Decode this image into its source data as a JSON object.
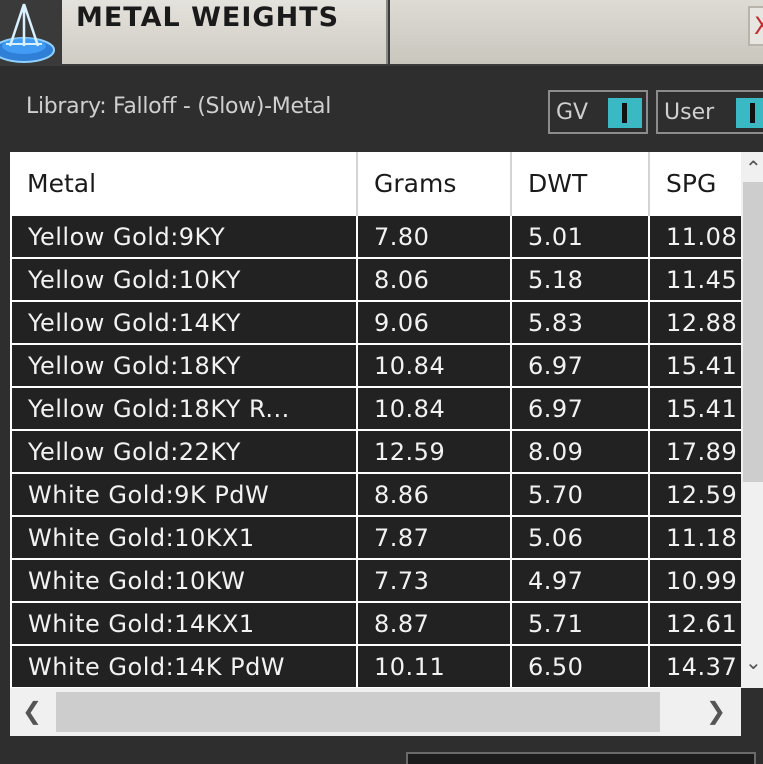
{
  "window": {
    "title": "METAL WEIGHTS",
    "close_label": "X"
  },
  "library": {
    "label": "Library: Falloff - (Slow)-Metal"
  },
  "toggles": [
    {
      "label": "GV"
    },
    {
      "label": "User"
    }
  ],
  "table": {
    "columns": [
      "Metal",
      "Grams",
      "DWT",
      "SPG"
    ],
    "rows": [
      {
        "metal": "Yellow Gold:9KY",
        "grams": "7.80",
        "dwt": "5.01",
        "spg": "11.08"
      },
      {
        "metal": "Yellow Gold:10KY",
        "grams": "8.06",
        "dwt": "5.18",
        "spg": "11.45"
      },
      {
        "metal": "Yellow Gold:14KY",
        "grams": "9.06",
        "dwt": "5.83",
        "spg": "12.88"
      },
      {
        "metal": "Yellow Gold:18KY",
        "grams": "10.84",
        "dwt": "6.97",
        "spg": "15.41"
      },
      {
        "metal": "Yellow Gold:18KY R...",
        "grams": "10.84",
        "dwt": "6.97",
        "spg": "15.41"
      },
      {
        "metal": "Yellow Gold:22KY",
        "grams": "12.59",
        "dwt": "8.09",
        "spg": "17.89"
      },
      {
        "metal": "White Gold:9K PdW",
        "grams": "8.86",
        "dwt": "5.70",
        "spg": "12.59"
      },
      {
        "metal": "White Gold:10KX1",
        "grams": "7.87",
        "dwt": "5.06",
        "spg": "11.18"
      },
      {
        "metal": "White Gold:10KW",
        "grams": "7.73",
        "dwt": "4.97",
        "spg": "10.99"
      },
      {
        "metal": "White Gold:14KX1",
        "grams": "8.87",
        "dwt": "5.71",
        "spg": "12.61"
      },
      {
        "metal": "White Gold:14K PdW",
        "grams": "10.11",
        "dwt": "6.50",
        "spg": "14.37"
      }
    ]
  },
  "colors": {
    "accent_toggle": "#3ab8c4",
    "row_background": "#222222",
    "window_background": "#2e2e2e"
  },
  "icons": {
    "app": "scale-icon",
    "scroll_up": "chevron-up-icon",
    "scroll_down": "chevron-down-icon",
    "scroll_left": "chevron-left-icon",
    "scroll_right": "chevron-right-icon"
  }
}
